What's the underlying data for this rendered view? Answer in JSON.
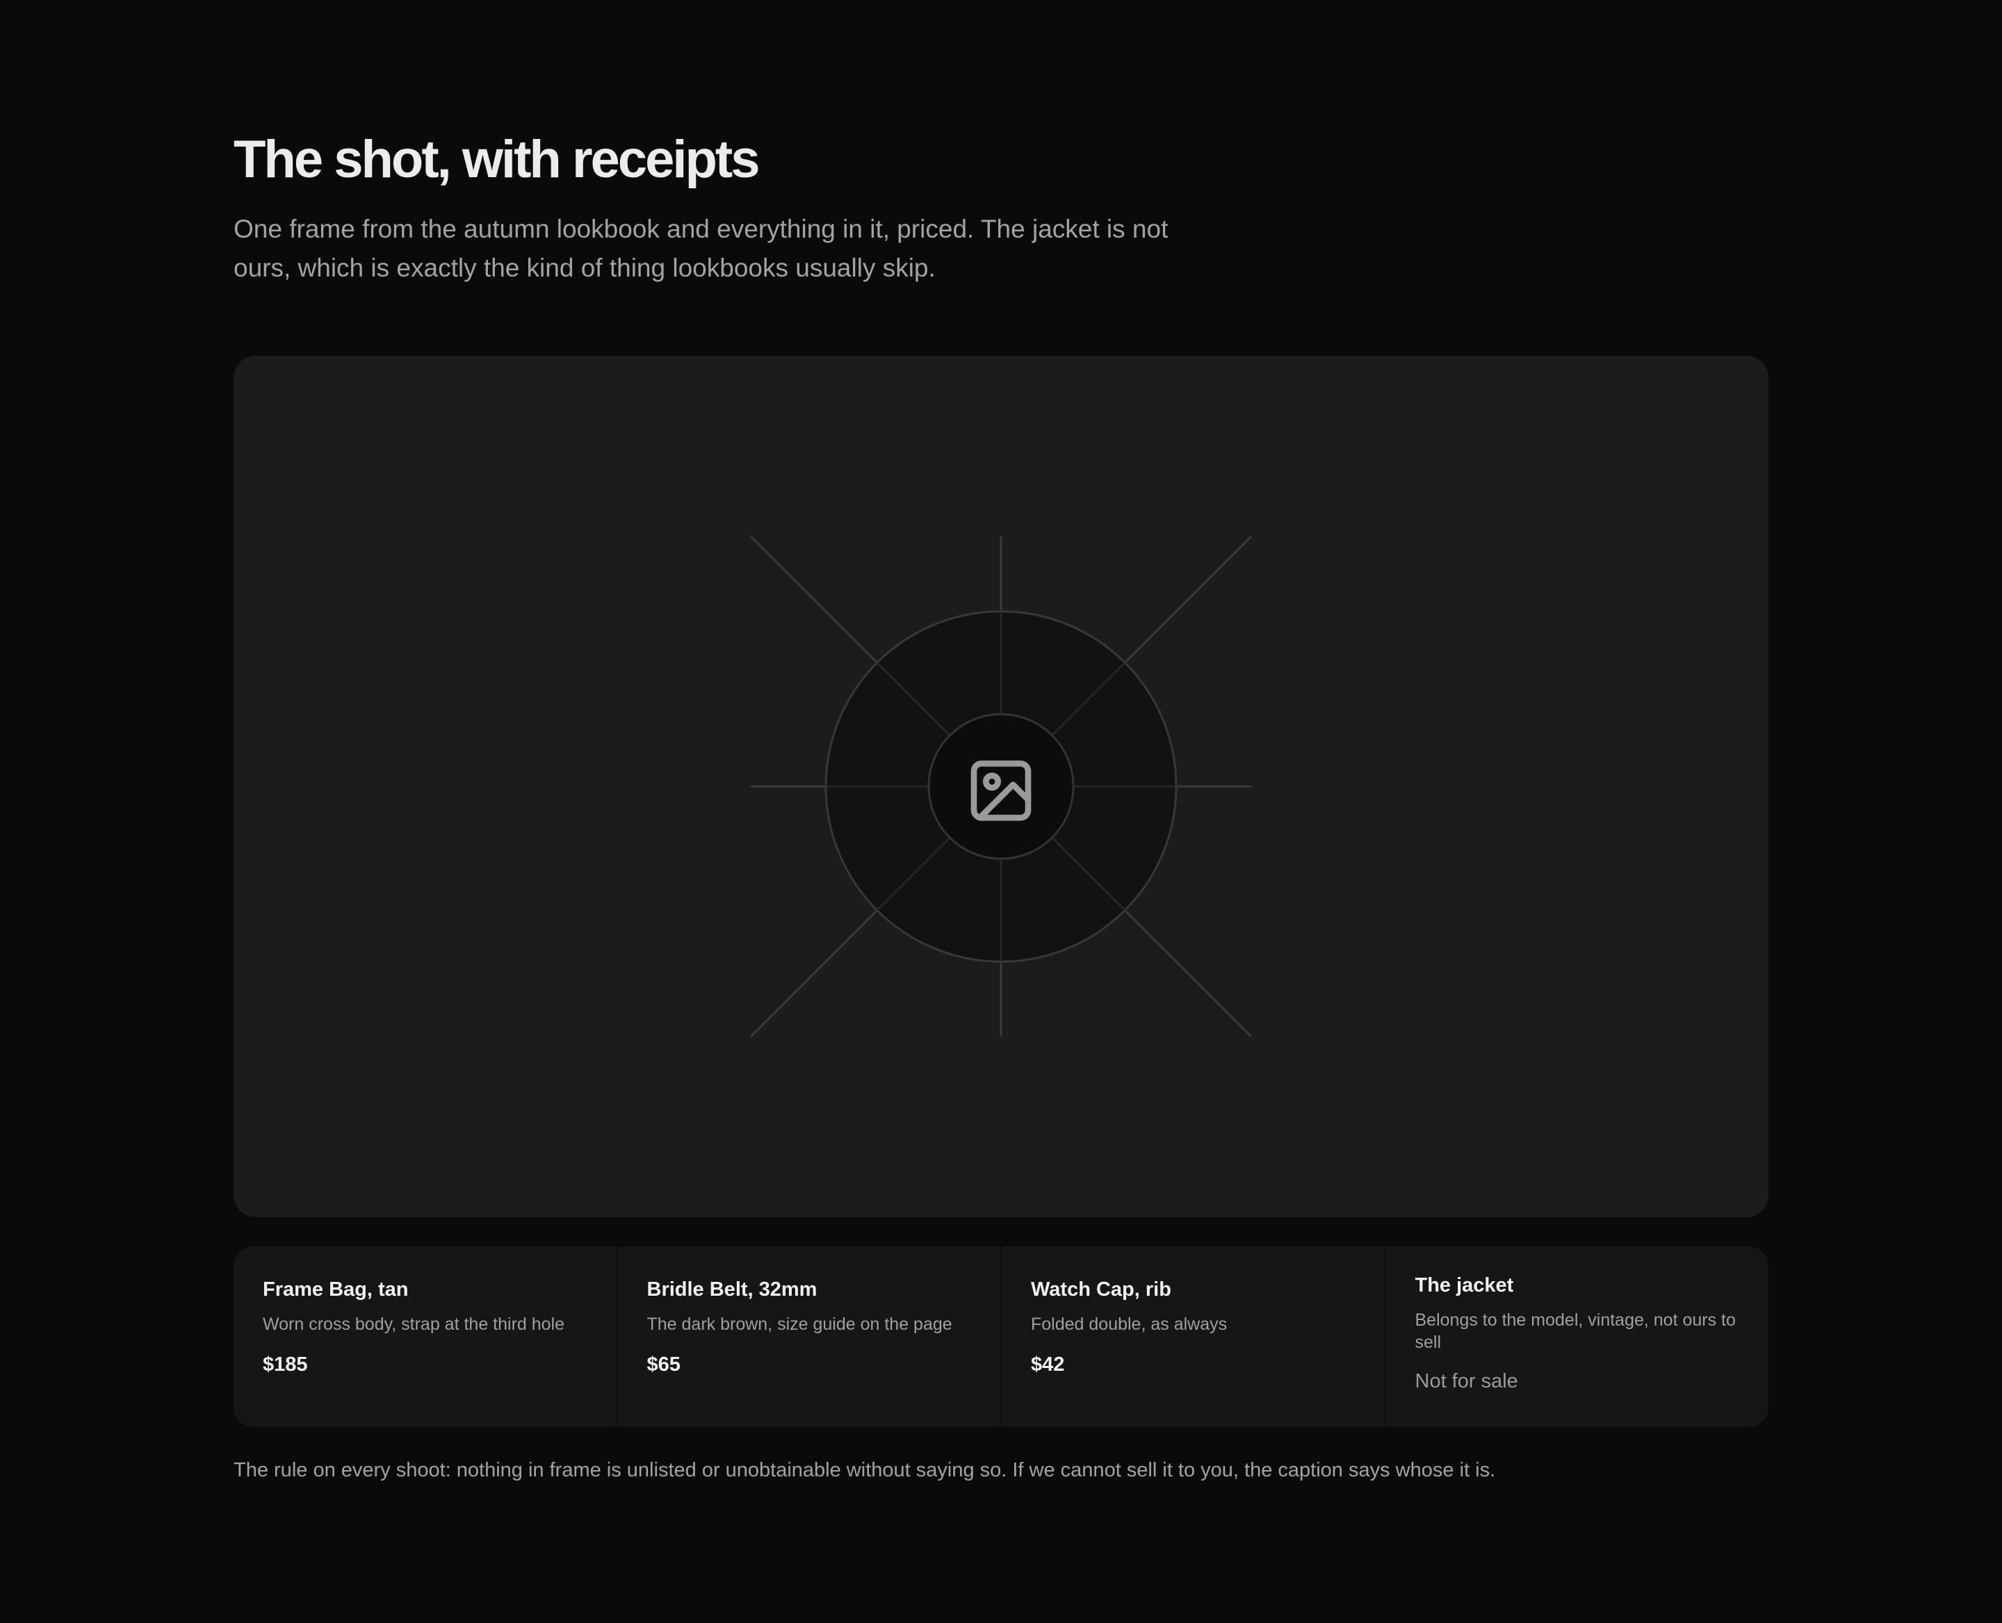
{
  "header": {
    "title": "The shot, with receipts",
    "subtitle": "One frame from the autumn lookbook and everything in it, priced. The jacket is not ours, which is exactly the kind of thing lookbooks usually skip."
  },
  "hero": {
    "icon": "image-icon",
    "colors": {
      "background": "#1c1c1c",
      "rays": "#3a3a3a",
      "outer_circle": "#111111",
      "inner_circle": "#0c0c0c",
      "icon": "#9a9a9a"
    }
  },
  "products": [
    {
      "name": "Frame Bag, tan",
      "description": "Worn cross body, strap at the third hole",
      "price": "$185"
    },
    {
      "name": "Bridle Belt, 32mm",
      "description": "The dark brown, size guide on the page",
      "price": "$65"
    },
    {
      "name": "Watch Cap, rib",
      "description": "Folded double, as always",
      "price": "$42"
    },
    {
      "name": "The jacket",
      "description": "Belongs to the model, vintage, not ours to sell",
      "price": "Not for sale"
    }
  ],
  "footnote": "The rule on every shoot: nothing in frame is unlisted or unobtainable without saying so. If we cannot sell it to you, the caption says whose it is."
}
